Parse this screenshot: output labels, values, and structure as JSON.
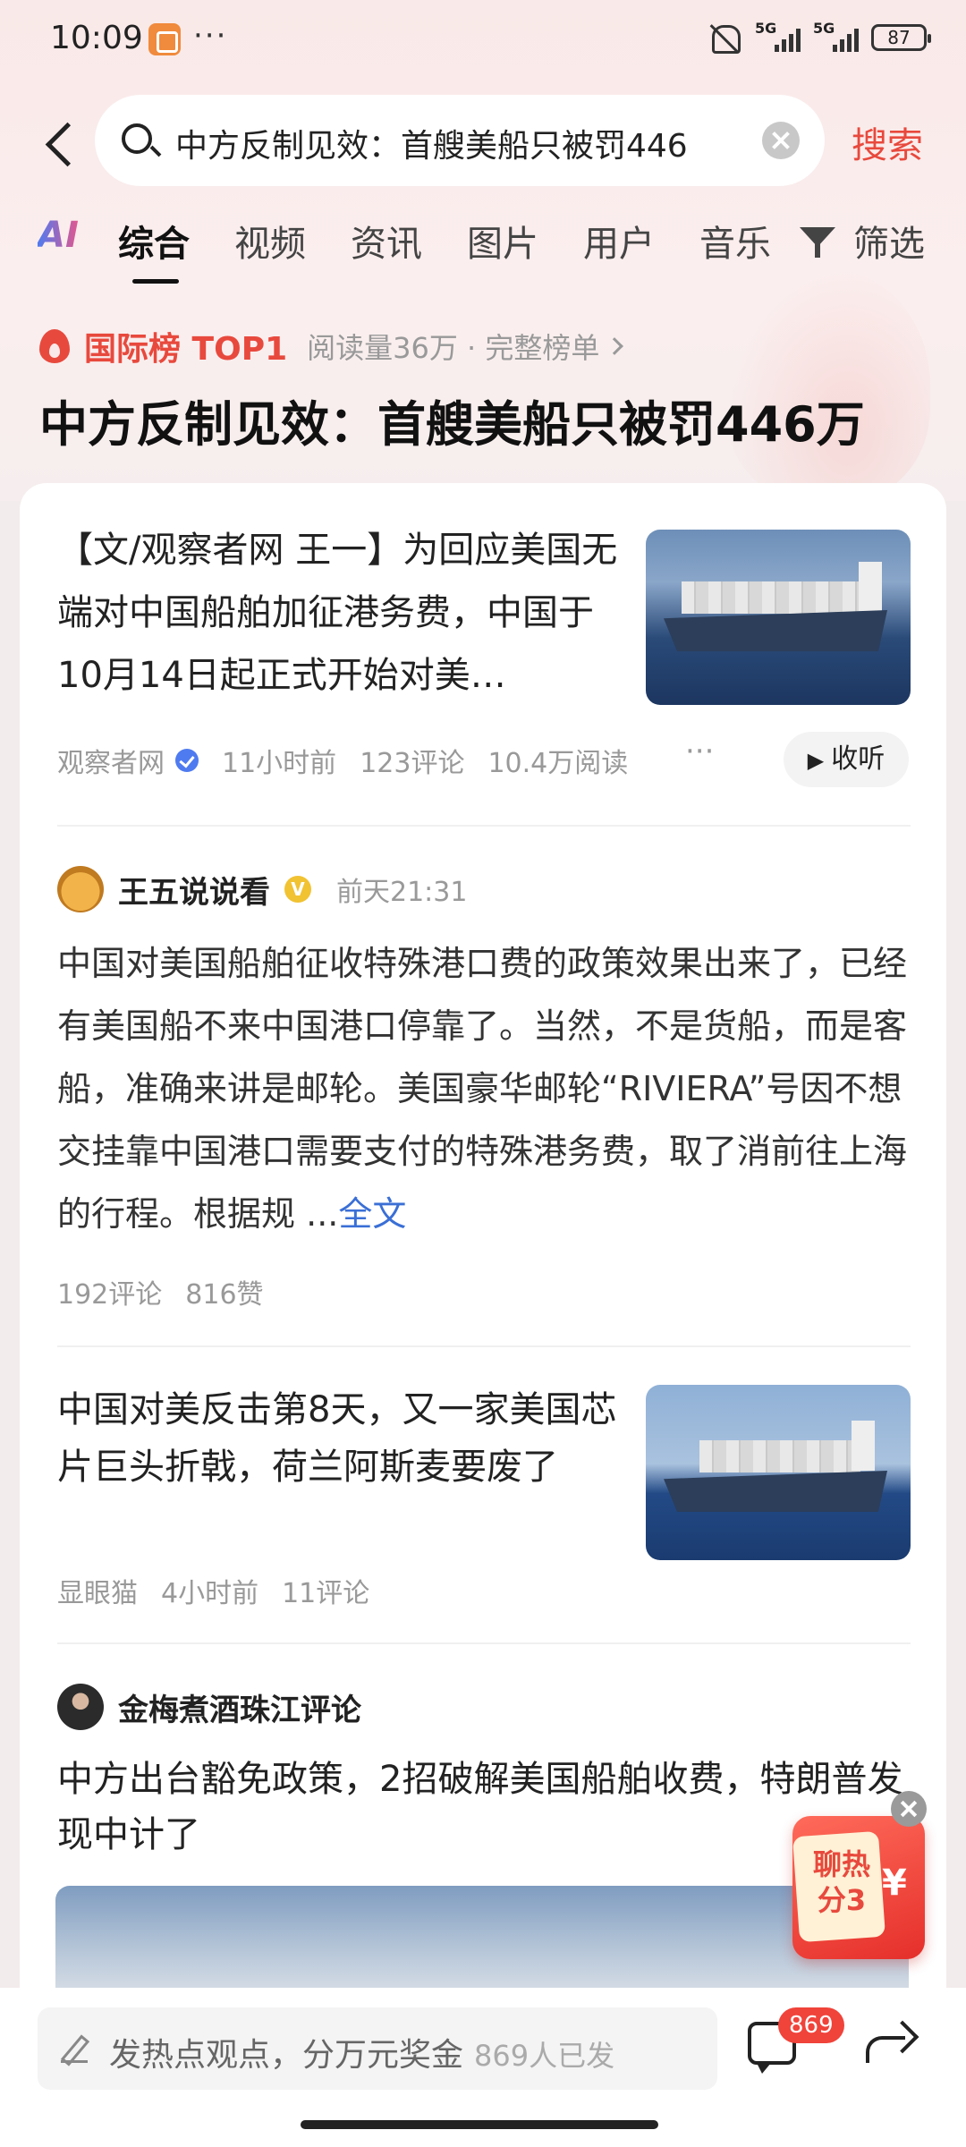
{
  "status_bar": {
    "time": "10:09",
    "more": "···",
    "network_1": "5G",
    "network_2": "5G",
    "battery": "87"
  },
  "search": {
    "query": "中方反制见效：首艘美船只被罚446",
    "action_label": "搜索"
  },
  "tabs": [
    {
      "label": "AI"
    },
    {
      "label": "综合"
    },
    {
      "label": "视频"
    },
    {
      "label": "资讯"
    },
    {
      "label": "图片"
    },
    {
      "label": "用户"
    },
    {
      "label": "音乐"
    },
    {
      "label": "筛选"
    }
  ],
  "active_tab": "综合",
  "hot": {
    "rank_label": "国际榜 TOP1",
    "meta": "阅读量36万 · 完整榜单",
    "topic_title": "中方反制见效：首艘美船只被罚446万"
  },
  "results": {
    "news1": {
      "title": "【文/观察者网 王一】为回应美国无端对中国船舶加征港务费，中国于10月14日起正式开始对美…",
      "source": "观察者网",
      "time": "11小时前",
      "comments": "123评论",
      "reads": "10.4万阅读",
      "more": "···",
      "listen": "收听"
    },
    "post1": {
      "author": "王五说说看",
      "vip": "V",
      "time": "前天21:31",
      "body": "中国对美国船舶征收特殊港口费的政策效果出来了，已经有美国船不来中国港口停靠了。当然，不是货船，而是客船，准确来讲是邮轮。美国豪华邮轮“RIVIERA”号因不想交挂靠中国港口需要支付的特殊港务费，取了消前往上海的行程。根据规",
      "ellipsis": "...",
      "fulltext": "全文",
      "comments": "192评论",
      "likes": "816赞"
    },
    "news2": {
      "title": "中国对美反击第8天，又一家美国芯片巨头折戟，荷兰阿斯麦要废了",
      "source": "显眼猫",
      "time": "4小时前",
      "comments": "11评论"
    },
    "post2": {
      "author": "金梅煮酒珠江评论",
      "title": "中方出台豁免政策，2招破解美国船舶收费，特朗普发现中计了"
    }
  },
  "float_packet": {
    "text": "聊热分3",
    "yuan": "¥"
  },
  "bottom_bar": {
    "placeholder": "发热点观点，分万元奖金",
    "count_text": "869人已发",
    "message_badge": "869"
  },
  "colors": {
    "accent_red": "#e8493d",
    "link_blue": "#3a6fd6",
    "verified_blue": "#4f7bf0",
    "vip_gold": "#f1c232"
  },
  "icons": [
    "back-icon",
    "search-icon",
    "clear-icon",
    "filter-icon",
    "fire-icon",
    "verified-icon",
    "more-icon",
    "play-icon",
    "close-icon",
    "pen-icon",
    "message-icon",
    "share-icon"
  ]
}
